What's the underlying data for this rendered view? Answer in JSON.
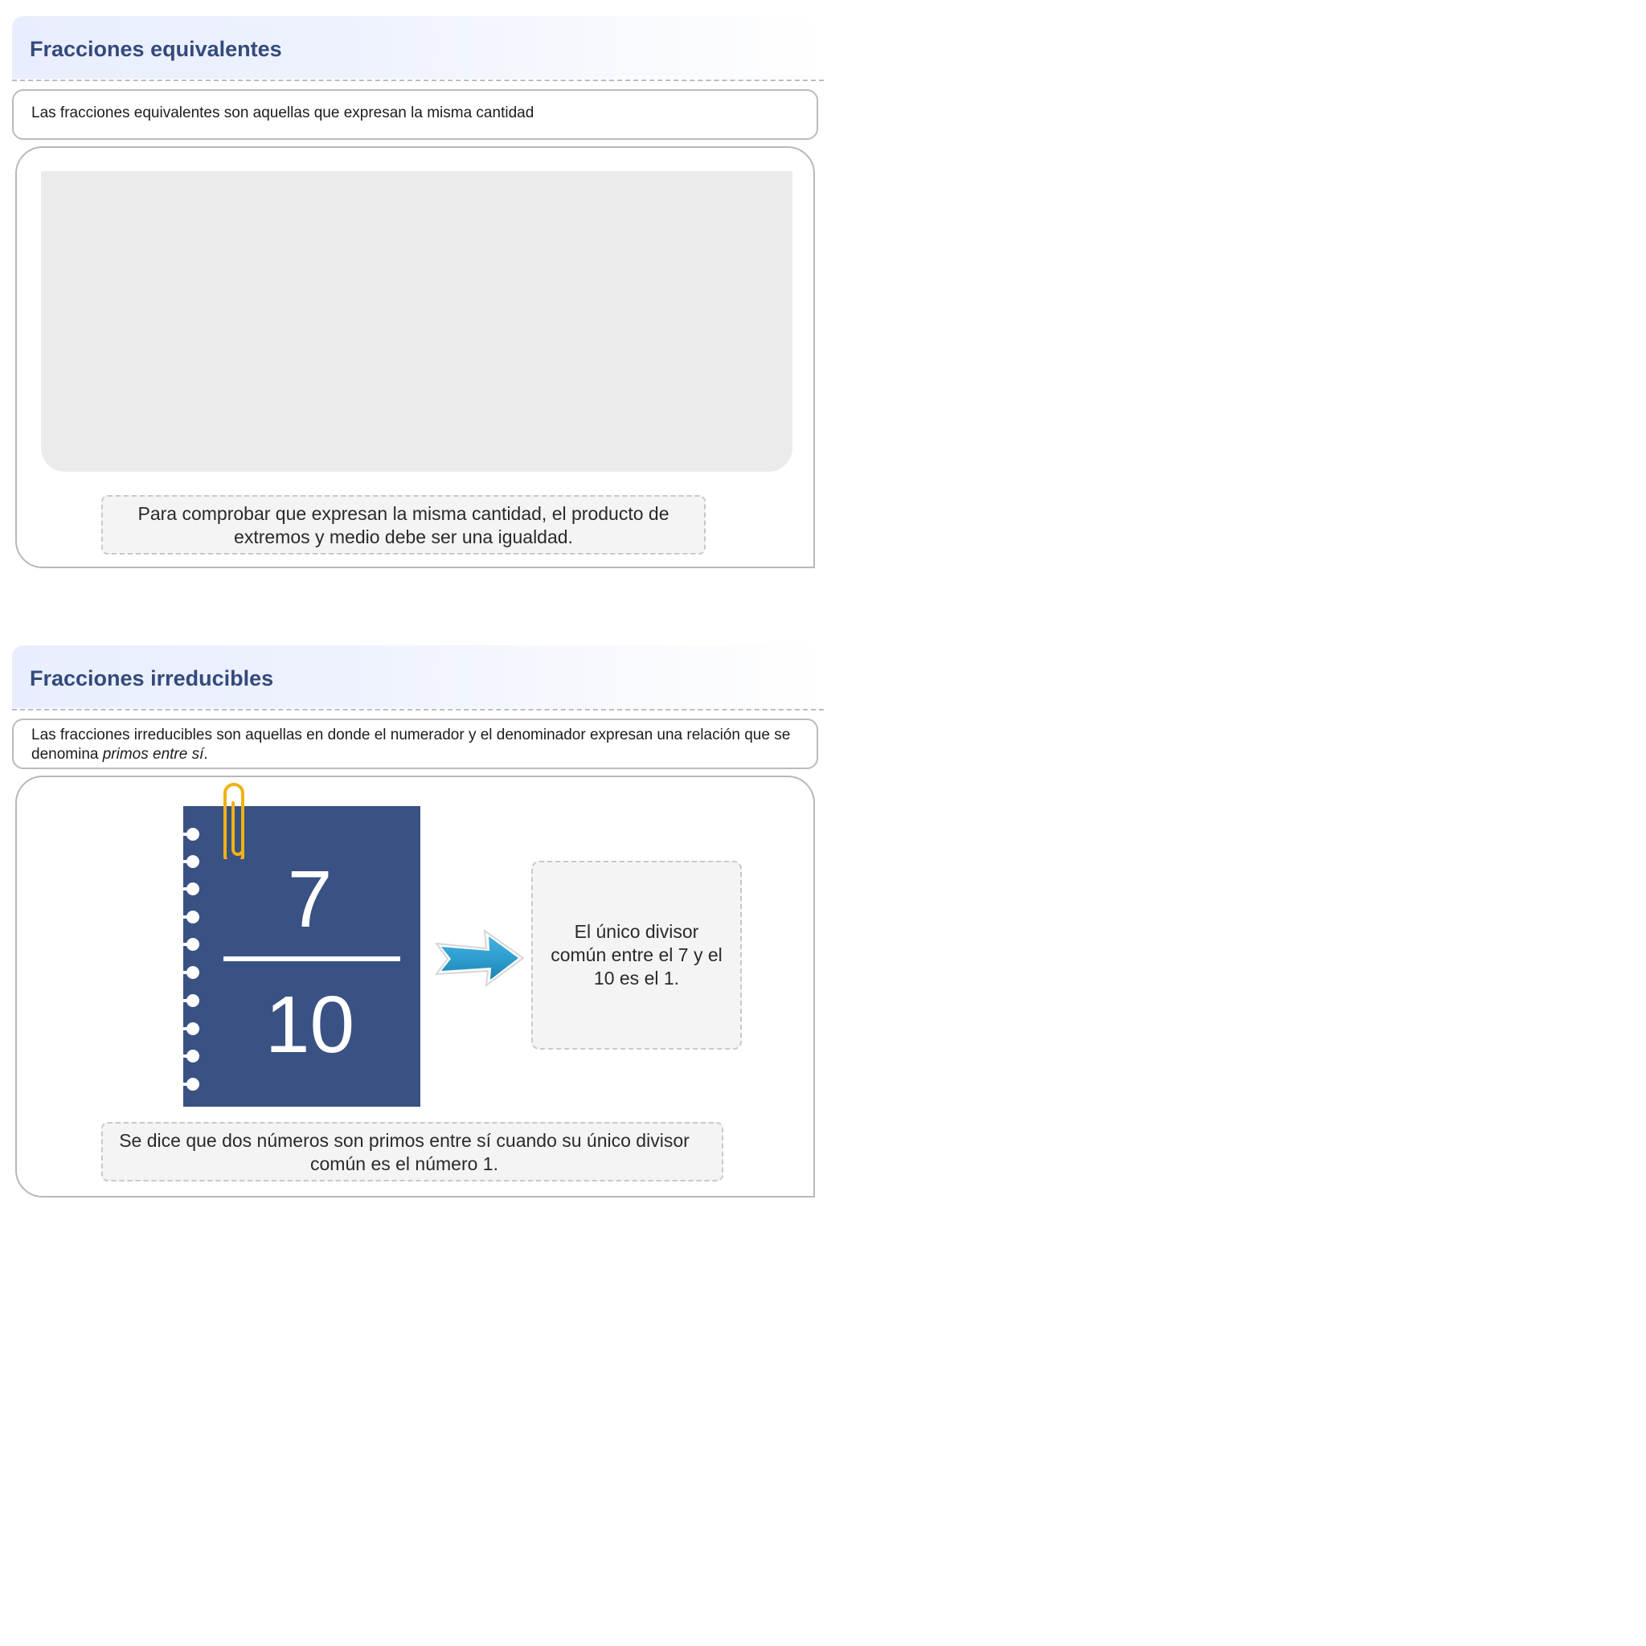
{
  "section1": {
    "title": "Fracciones equivalentes",
    "description": "Las fracciones equivalentes son aquellas que expresan la misma cantidad",
    "caption": "Para comprobar que expresan la misma cantidad, el producto de extremos y medio debe ser una igualdad."
  },
  "section2": {
    "title": "Fracciones irreducibles",
    "description_main": "Las fracciones irreducibles son aquellas en donde el numerador y el denominador expresan una relación que se denomina ",
    "description_italic": "primos entre sí",
    "description_end": ".",
    "numerator": "7",
    "denominator": "10",
    "note": "El único divisor común entre el 7 y el 10 es el 1.",
    "caption": "Se dice que dos números son primos entre sí cuando su único divisor común es el número 1."
  },
  "icons": {
    "arrow": "arrow-right-icon",
    "paperclip": "paperclip-icon",
    "arrow_color": "#2e9ed0",
    "clip_color": "#f0b213",
    "notebook_color": "#3a5183"
  }
}
